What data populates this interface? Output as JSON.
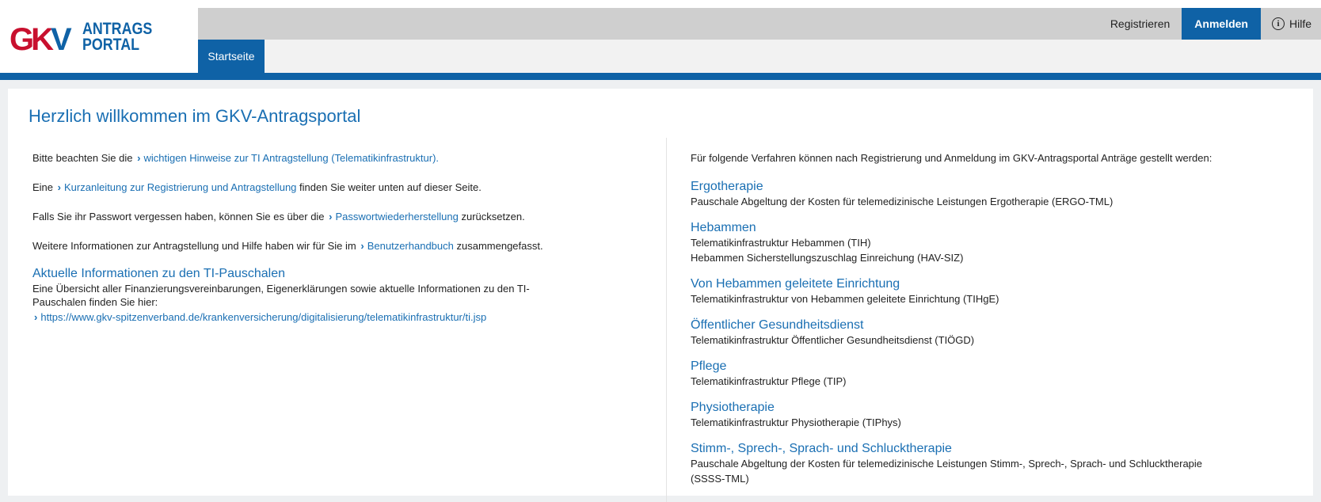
{
  "header": {
    "logo_mark": "GK",
    "logo_mark_v": "V",
    "logo_line1": "ANTRAGS",
    "logo_line2": "PORTAL",
    "tab_start": "Startseite",
    "register": "Registrieren",
    "login": "Anmelden",
    "help": "Hilfe"
  },
  "main": {
    "title": "Herzlich willkommen im GKV-Antragsportal",
    "left": {
      "p1_pre": "Bitte beachten Sie die",
      "p1_link": "wichtigen Hinweise zur TI Antragstellung (Telematikinfrastruktur).",
      "p2_pre": "Eine",
      "p2_link": "Kurzanleitung zur Registrierung und Antragstellung",
      "p2_post": "finden Sie weiter unten auf dieser Seite.",
      "p3_pre": "Falls Sie ihr Passwort vergessen haben, können Sie es über die",
      "p3_link": "Passwortwiederherstellung",
      "p3_post": "zurücksetzen.",
      "p4_pre": "Weitere Informationen zur Antragstellung und Hilfe haben wir für Sie im",
      "p4_link": "Benutzerhandbuch",
      "p4_post": "zusammengefasst.",
      "section_heading": "Aktuelle Informationen zu den TI-Pauschalen",
      "section_text_1": "Eine Übersicht aller Finanzierungsvereinbarungen, Eigenerklärungen sowie aktuelle Informationen zu den TI-",
      "section_text_2": "Pauschalen finden Sie hier:",
      "section_link": "https://www.gkv-spitzenverband.de/krankenversicherung/digitalisierung/telematikinfrastruktur/ti.jsp"
    },
    "right": {
      "intro": "Für folgende Verfahren können nach Registrierung und Anmeldung im GKV-Antragsportal Anträge gestellt werden:",
      "procedures": [
        {
          "heading": "Ergotherapie",
          "lines": [
            "Pauschale Abgeltung der Kosten für telemedizinische Leistungen Ergotherapie (ERGO-TML)"
          ]
        },
        {
          "heading": "Hebammen",
          "lines": [
            "Telematikinfrastruktur Hebammen (TIH)",
            "Hebammen Sicherstellungszuschlag Einreichung (HAV-SIZ)"
          ]
        },
        {
          "heading": "Von Hebammen geleitete Einrichtung",
          "lines": [
            "Telematikinfrastruktur von Hebammen geleitete Einrichtung (TIHgE)"
          ]
        },
        {
          "heading": "Öffentlicher Gesundheitsdienst",
          "lines": [
            "Telematikinfrastruktur Öffentlicher Gesundheitsdienst (TIÖGD)"
          ]
        },
        {
          "heading": "Pflege",
          "lines": [
            "Telematikinfrastruktur Pflege (TIP)"
          ]
        },
        {
          "heading": "Physiotherapie",
          "lines": [
            "Telematikinfrastruktur Physiotherapie (TIPhys)"
          ]
        },
        {
          "heading": "Stimm-, Sprech-, Sprach- und Schlucktherapie",
          "lines": [
            "Pauschale Abgeltung der Kosten für telemedizinische Leistungen Stimm-, Sprech-, Sprach- und Schlucktherapie",
            "(SSSS-TML)"
          ]
        }
      ]
    }
  }
}
